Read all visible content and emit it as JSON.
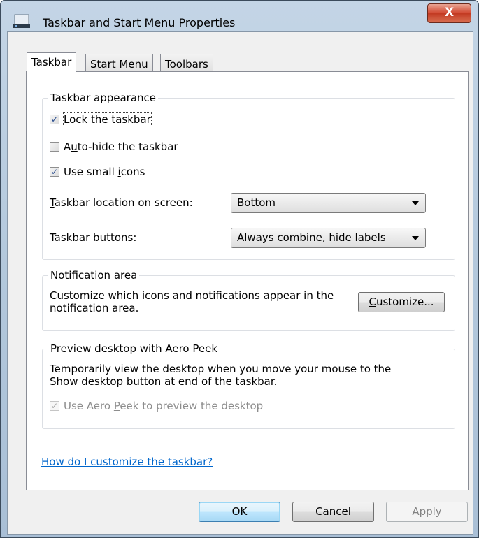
{
  "window": {
    "title": "Taskbar and Start Menu Properties",
    "close_label": "X"
  },
  "tabs": [
    {
      "label": "Taskbar",
      "active": true
    },
    {
      "label": "Start Menu",
      "active": false
    },
    {
      "label": "Toolbars",
      "active": false
    }
  ],
  "appearance": {
    "title": "Taskbar appearance",
    "lock_taskbar": {
      "pre": "",
      "key": "L",
      "post": "ock the taskbar",
      "checked": true
    },
    "auto_hide": {
      "pre": "A",
      "key": "u",
      "post": "to-hide the taskbar",
      "checked": false
    },
    "small_icons": {
      "pre": "Use small ",
      "key": "i",
      "post": "cons",
      "checked": true
    },
    "location_label": {
      "pre": "",
      "key": "T",
      "post": "askbar location on screen:"
    },
    "location_value": "Bottom",
    "buttons_label": {
      "pre": "Taskbar ",
      "key": "b",
      "post": "uttons:"
    },
    "buttons_value": "Always combine, hide labels"
  },
  "notification": {
    "title": "Notification area",
    "line1": "Customize which icons and notifications appear in the",
    "line2": "notification area.",
    "customize_button": {
      "pre": "",
      "key": "C",
      "post": "ustomize..."
    }
  },
  "aero_peek": {
    "title": "Preview desktop with Aero Peek",
    "line1": "Temporarily view the desktop when you move your mouse to the",
    "line2": "Show desktop button at end of the taskbar.",
    "checkbox": {
      "pre": "Use Aero ",
      "key": "P",
      "post": "eek to preview the desktop",
      "checked": true,
      "disabled": true
    }
  },
  "help_link": "How do I customize the taskbar?",
  "footer": {
    "ok": "OK",
    "cancel": "Cancel",
    "apply": {
      "pre": "",
      "key": "A",
      "post": "pply"
    }
  },
  "check_mark": "✓",
  "colors": {
    "link": "#0066cc",
    "close_button": "#c23a22",
    "default_button_border": "#3c7fb1"
  }
}
